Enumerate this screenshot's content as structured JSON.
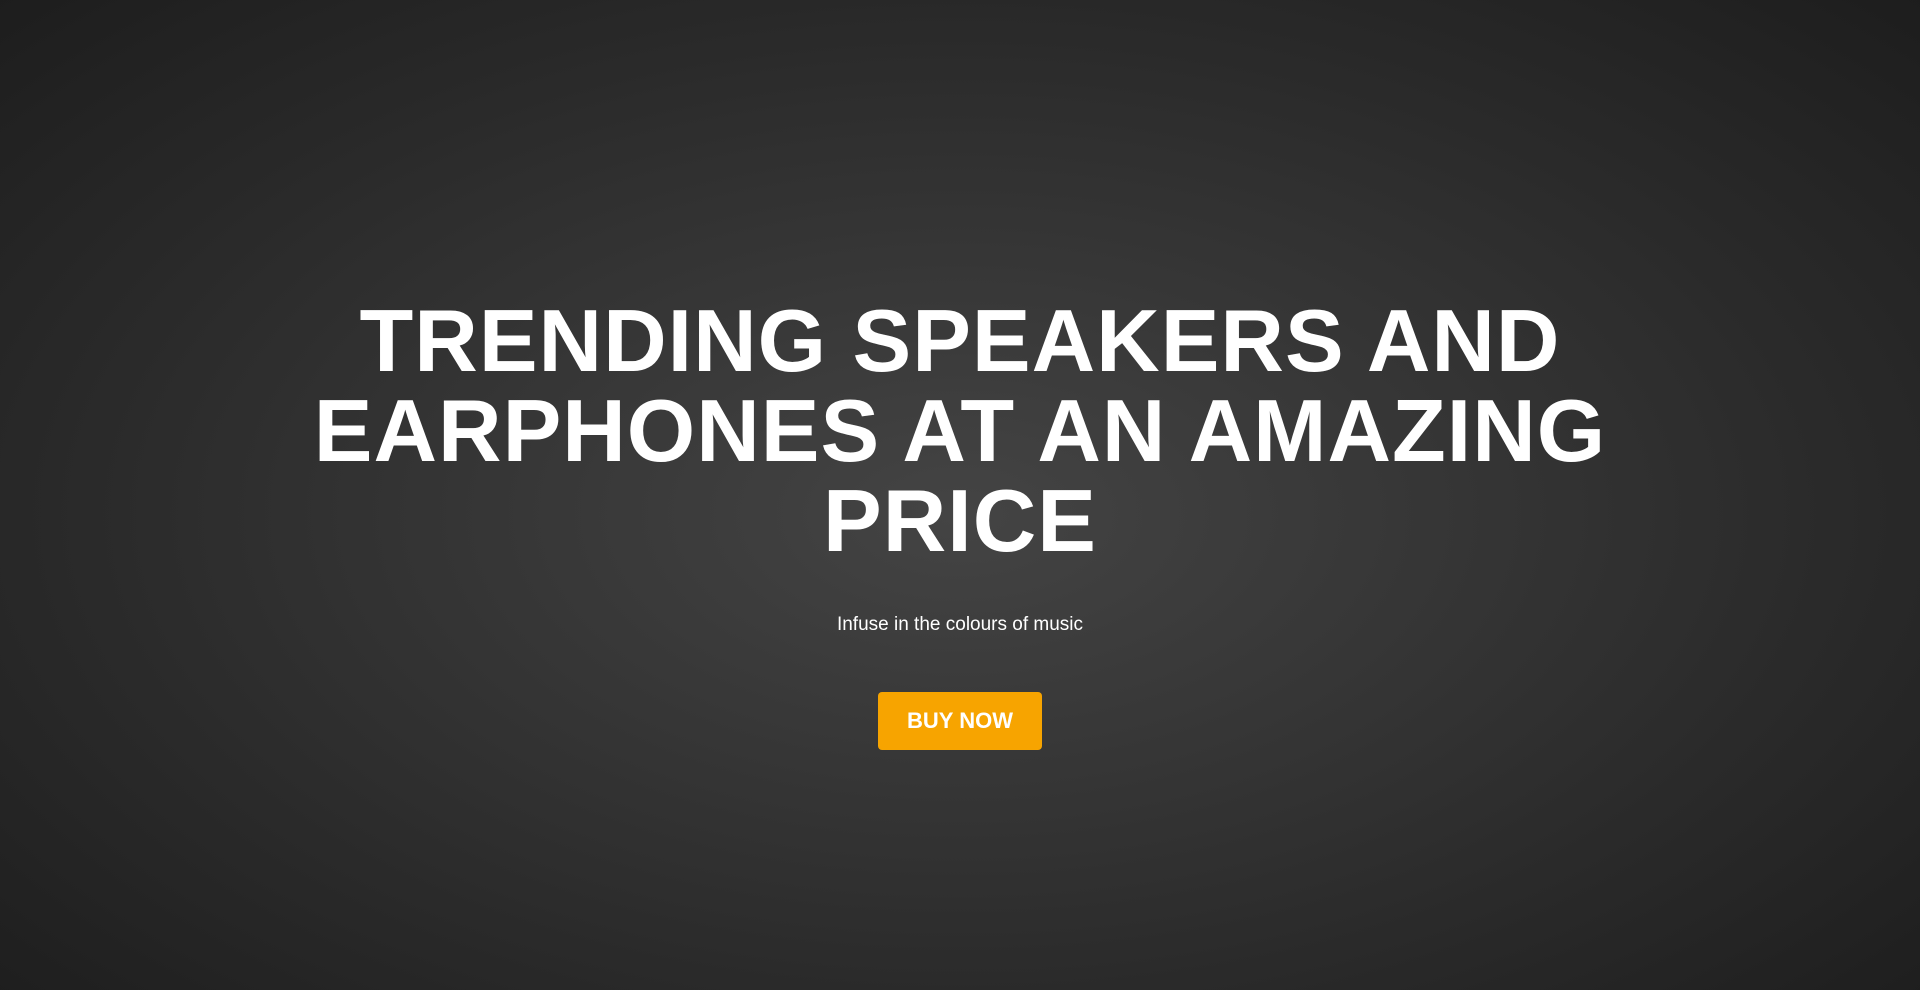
{
  "hero": {
    "headline": "TRENDING SPEAKERS AND EARPHONES AT AN AMAZING PRICE",
    "tagline": "Infuse in the colours of music",
    "cta_label": "BUY NOW"
  },
  "colors": {
    "background": "#2f2f2f",
    "text": "#ffffff",
    "accent": "#f7a400"
  }
}
